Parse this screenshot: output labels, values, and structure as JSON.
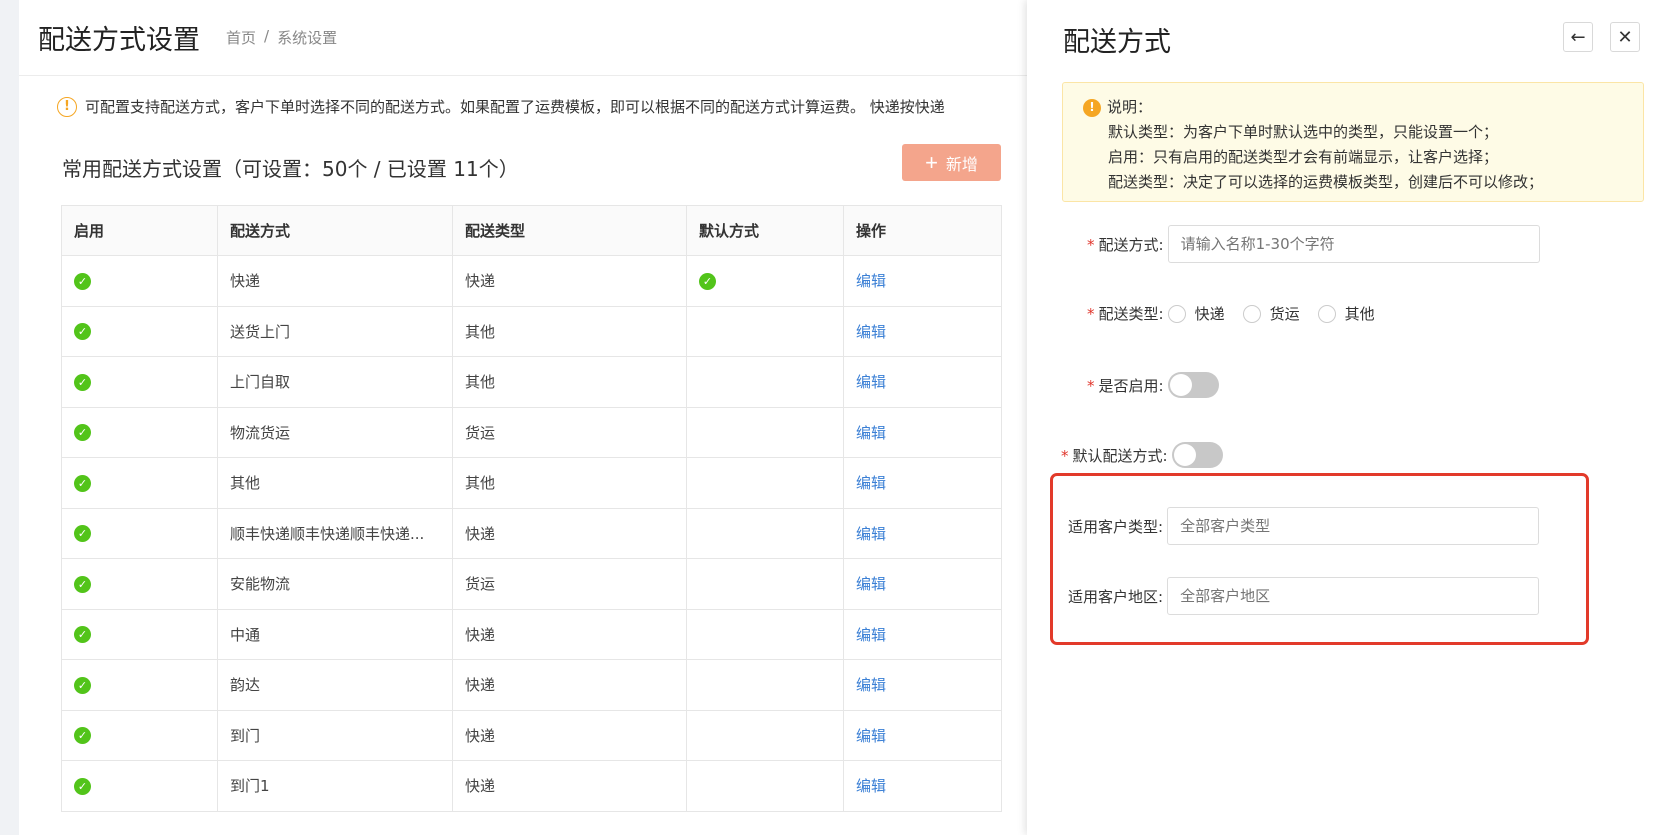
{
  "header": {
    "title": "配送方式设置",
    "breadcrumb": [
      "首页",
      "/",
      "系统设置"
    ]
  },
  "notice": {
    "icon": "warning-circle-icon",
    "text": "可配置支持配送方式，客户下单时选择不同的配送方式。如果配置了运费模板，即可以根据不同的配送方式计算运费。 快递按快递"
  },
  "section": {
    "title": "常用配送方式设置（可设置：50个 / 已设置 11个）",
    "add_label": "新增",
    "add_icon": "+"
  },
  "table": {
    "columns": [
      "启用",
      "配送方式",
      "配送类型",
      "默认方式",
      "操作"
    ],
    "rows": [
      {
        "enabled": true,
        "name": "快递",
        "type": "快递",
        "default": true,
        "action": "编辑"
      },
      {
        "enabled": true,
        "name": "送货上门",
        "type": "其他",
        "default": false,
        "action": "编辑"
      },
      {
        "enabled": true,
        "name": "上门自取",
        "type": "其他",
        "default": false,
        "action": "编辑"
      },
      {
        "enabled": true,
        "name": "物流货运",
        "type": "货运",
        "default": false,
        "action": "编辑"
      },
      {
        "enabled": true,
        "name": "其他",
        "type": "其他",
        "default": false,
        "action": "编辑"
      },
      {
        "enabled": true,
        "name": "顺丰快递顺丰快递顺丰快递...",
        "type": "快递",
        "default": false,
        "action": "编辑"
      },
      {
        "enabled": true,
        "name": "安能物流",
        "type": "货运",
        "default": false,
        "action": "编辑"
      },
      {
        "enabled": true,
        "name": "中通",
        "type": "快递",
        "default": false,
        "action": "编辑"
      },
      {
        "enabled": true,
        "name": "韵达",
        "type": "快递",
        "default": false,
        "action": "编辑"
      },
      {
        "enabled": true,
        "name": "到门",
        "type": "快递",
        "default": false,
        "action": "编辑"
      },
      {
        "enabled": true,
        "name": "到门1",
        "type": "快递",
        "default": false,
        "action": "编辑"
      }
    ]
  },
  "drawer": {
    "title": "配送方式",
    "collapse_icon": "←",
    "close_icon": "✕",
    "info": {
      "heading": "说明：",
      "lines": [
        "默认类型：为客户下单时默认选中的类型，只能设置一个；",
        "启用：只有启用的配送类型才会有前端显示，让客户选择；",
        "配送类型：决定了可以选择的运费模板类型，创建后不可以修改；"
      ]
    },
    "form": {
      "name_label": "配送方式:",
      "name_placeholder": "请输入名称1-30个字符",
      "type_label": "配送类型:",
      "type_options": [
        "快递",
        "货运",
        "其他"
      ],
      "enabled_label": "是否启用:",
      "enabled_value": false,
      "default_label": "默认配送方式:",
      "default_value": false,
      "customer_type_label": "适用客户类型:",
      "customer_type_placeholder": "全部客户类型",
      "customer_region_label": "适用客户地区:",
      "customer_region_placeholder": "全部客户地区"
    }
  },
  "colors": {
    "accent": "#f4a58c",
    "link": "#3a7fd5",
    "success": "#52c41a",
    "warning": "#f5a623",
    "required": "#e0362c",
    "highlight_border": "#e23a2a"
  }
}
